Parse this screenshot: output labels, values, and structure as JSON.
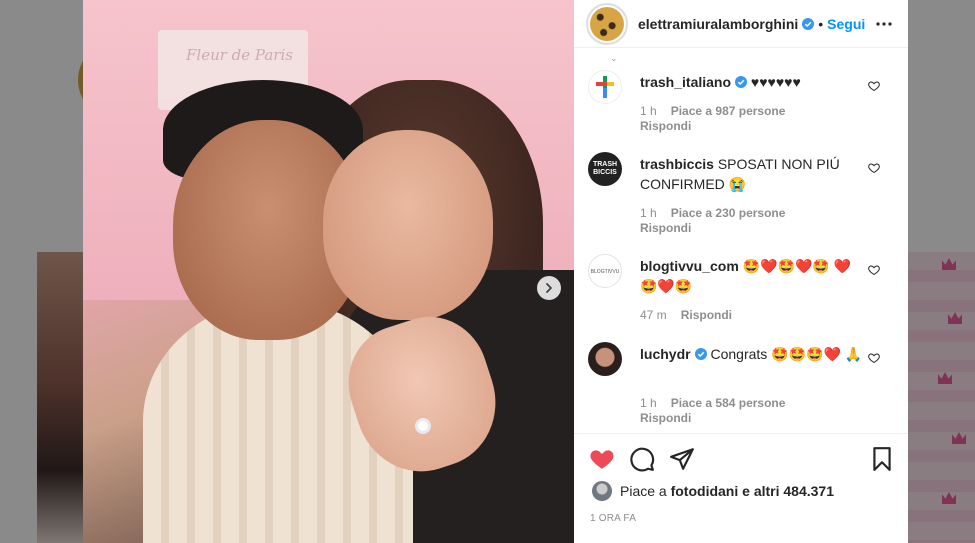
{
  "post": {
    "username": "elettramiuralamborghini",
    "dot": "•",
    "follow_label": "Segui",
    "time_ago": "1 ORA FA",
    "likes": {
      "prefix": "Piace a",
      "user": "fotodidani",
      "suffix": "e altri 484.371"
    }
  },
  "photo": {
    "sign_text": "Fleur de Paris"
  },
  "comments": [
    {
      "user": "trash_italiano",
      "verified": true,
      "text": "♥♥♥♥♥♥",
      "time": "1 h",
      "likes": "Piace a 987 persone",
      "reply": "Rispondi"
    },
    {
      "user": "trashbiccis",
      "verified": false,
      "text": "SPOSATI NON PIÚ CONFIRMED 😭",
      "time": "1 h",
      "likes": "Piace a 230 persone",
      "reply": "Rispondi",
      "avatar_text": "TRASH BICCIS"
    },
    {
      "user": "blogtivvu_com",
      "verified": false,
      "text": "🤩❤️🤩❤️🤩 ❤️🤩❤️🤩",
      "time": "47 m",
      "likes": "",
      "reply": "Rispondi",
      "avatar_text": "BLOGTIVVU"
    },
    {
      "user": "luchydr",
      "verified": true,
      "text": "Congrats 🤩🤩🤩❤️ 🙏",
      "time": "1 h",
      "likes": "Piace a 584 persone",
      "reply": "Rispondi"
    }
  ],
  "colors": {
    "accent": "#0095f6",
    "heart_active": "#ed4956",
    "text": "#262626",
    "meta": "#8e8e8e"
  },
  "icons": [
    "chevron-right-icon",
    "more-icon",
    "verified-icon",
    "heart-outline-icon",
    "heart-filled-icon",
    "comment-icon",
    "share-icon",
    "bookmark-icon"
  ]
}
